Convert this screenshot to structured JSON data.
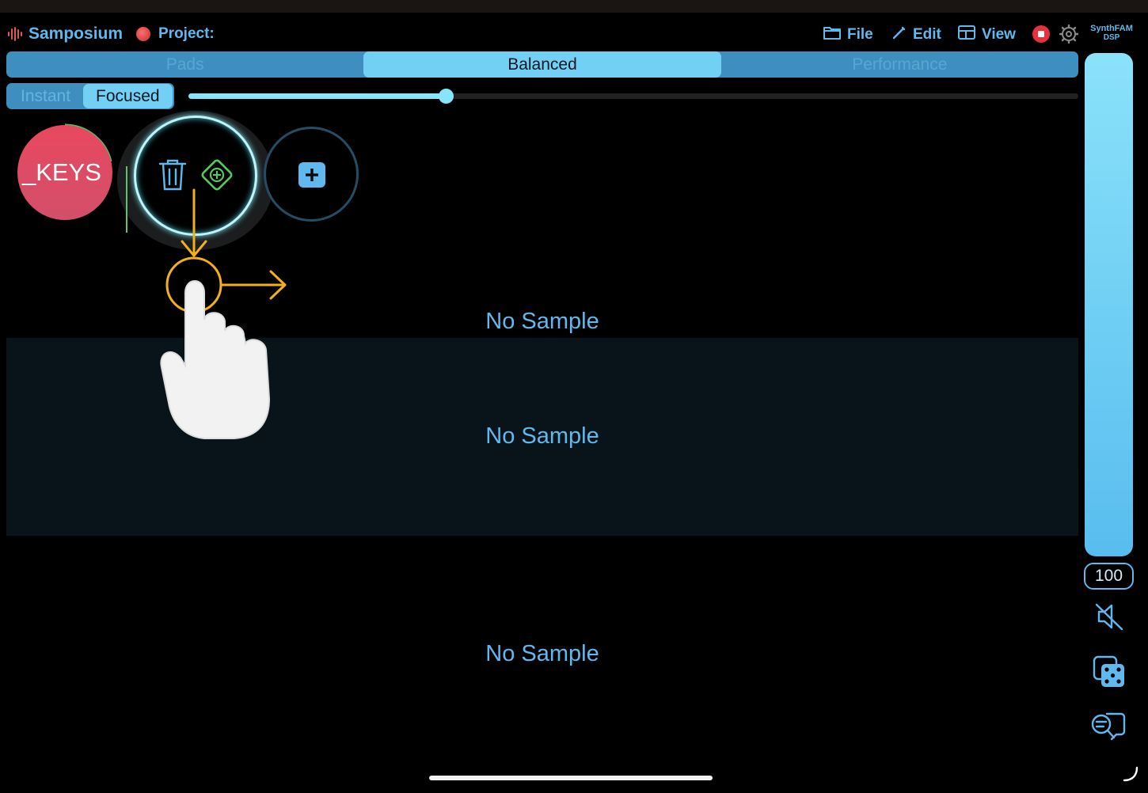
{
  "header": {
    "app_name": "Samposium",
    "project_label": "Project:",
    "menu": [
      {
        "label": "File",
        "icon": "folder-icon"
      },
      {
        "label": "Edit",
        "icon": "pencil-icon"
      },
      {
        "label": "View",
        "icon": "layout-icon"
      }
    ],
    "brand_line1": "SynthFAM",
    "brand_line2": "DSP"
  },
  "mode_tabs": [
    "Pads",
    "Balanced",
    "Performance"
  ],
  "mode_selected": "Balanced",
  "sub_tabs": [
    "Instant",
    "Focused"
  ],
  "sub_selected": "Focused",
  "slider": {
    "value_fraction": 0.29
  },
  "pads": {
    "keys_label": "_KEYS",
    "selected_actions": [
      "trash-icon",
      "add-diamond-icon"
    ],
    "add_button": "plus-icon"
  },
  "tracks": [
    {
      "label": "No Sample"
    },
    {
      "label": "No Sample"
    },
    {
      "label": "No Sample"
    }
  ],
  "volume": {
    "value": "100",
    "fraction": 1.0
  },
  "colors": {
    "accent": "#5fb8ee",
    "mode_bar": "#3e8fc0",
    "mode_active": "#72d0f4",
    "record": "#e8313c",
    "keys_pad": "#e8485f",
    "gesture": "#f3b116"
  }
}
